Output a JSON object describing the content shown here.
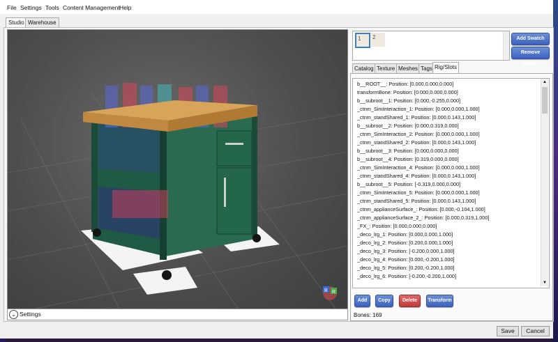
{
  "menu": [
    "File",
    "Settings",
    "Tools",
    "Content Management",
    "Help"
  ],
  "top_tabs": [
    "Studio",
    "Warehouse"
  ],
  "viewport": {
    "settings_label": "Settings",
    "gizmo_axes": [
      "B",
      "R"
    ]
  },
  "swatches": [
    "1",
    "2"
  ],
  "swatch_buttons": {
    "add": "Add Swatch",
    "remove": "Remove Swatch"
  },
  "right_tabs": [
    "Catalog",
    "Texture",
    "Meshes",
    "Tags",
    "Rig/Slots"
  ],
  "bones": [
    "b__ROOT__: Position: [0.000,0.000,0.000]",
    "transformBone: Position: [0.000,0.000,0.000]",
    "b__subroot__1: Position: [0.000,-0.255,0.000]",
    "_ctnm_SimInteraction_1: Position: [0.000,0.000,1.000]",
    "_ctnm_standShared_1: Position: [0.000,0.143,1.000]",
    "b__subroot__2: Position: [0.000,0.319,0.000]",
    "_ctnm_SimInteraction_2: Position: [0.000,0.000,1.000]",
    "_ctnm_standShared_2: Position: [0.000,0.143,1.000]",
    "b__subroot__3: Position: [0.000,0.000,0.000]",
    "b__subroot__4: Position: [0.319,0.000,0.000]",
    "_ctnm_SimInteraction_4: Position: [0.000,0.000,1.000]",
    "_ctnm_standShared_4: Position: [0.000,0.143,1.000]",
    "b__subroot__5: Position: [-0.319,0.000,0.000]",
    "_ctnm_SimInteraction_5: Position: [0.000,0.000,1.000]",
    "_ctnm_standShared_5: Position: [0.000,0.143,1.000]",
    "_ctnm_applianceSurface_: Position: [0.000,-0.104,1.000]",
    "_ctnm_applianceSurface_2_: Position: [0.000,0.319,1.000]",
    "_FX_: Position: [0.000,0.000,0.000]",
    "_deco_lrg_1: Position: [0.000,0.000,1.000]",
    "_deco_lrg_2: Position: [0.200,0.000,1.000]",
    "_deco_lrg_3: Position: [-0.200,0.000,1.000]",
    "_deco_lrg_4: Position: [0.000,-0.200,1.000]",
    "_deco_lrg_5: Position: [0.200,-0.200,1.000]",
    "_deco_lrg_6: Position: [-0.200,-0.200,1.000]"
  ],
  "actions": {
    "add": "Add",
    "copy": "Copy",
    "delete": "Delete",
    "transform": "Transform"
  },
  "bones_count": "Bones: 169",
  "footer": {
    "save": "Save",
    "cancel": "Cancel"
  }
}
